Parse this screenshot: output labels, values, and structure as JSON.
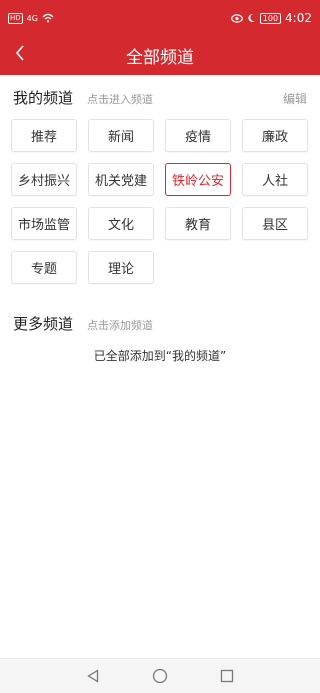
{
  "status_bar": {
    "sim_label": "HD",
    "signal_label": "4G",
    "battery_label": "100",
    "time": "4:02"
  },
  "nav": {
    "title": "全部频道",
    "back_icon": "chevron-left-icon"
  },
  "my_channels": {
    "title": "我的频道",
    "hint": "点击进入频道",
    "edit_label": "编辑",
    "selected_label": "铁岭公安",
    "items": [
      "推荐",
      "新闻",
      "疫情",
      "廉政",
      "乡村振兴",
      "机关党建",
      "铁岭公安",
      "人社",
      "市场监管",
      "文化",
      "教育",
      "县区",
      "专题",
      "理论"
    ]
  },
  "more_channels": {
    "title": "更多频道",
    "hint": "点击添加频道",
    "empty_message": "已全部添加到“我的频道”"
  },
  "colors": {
    "accent": "#d42a2f",
    "hint_gray": "#9a9a9a"
  }
}
